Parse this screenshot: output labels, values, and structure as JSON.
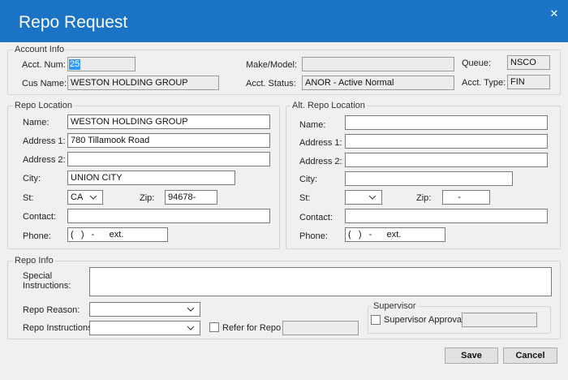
{
  "window": {
    "title": "Repo Request",
    "close_glyph": "✕"
  },
  "account_info": {
    "legend": "Account Info",
    "acct_num_label": "Acct. Num:",
    "acct_num": "25",
    "cus_name_label": "Cus Name:",
    "cus_name": "WESTON HOLDING GROUP",
    "make_model_label": "Make/Model:",
    "make_model": "",
    "acct_status_label": "Acct. Status:",
    "acct_status": "ANOR - Active Normal",
    "queue_label": "Queue:",
    "queue": "NSCO",
    "acct_type_label": "Acct. Type:",
    "acct_type": "FIN"
  },
  "repo_location": {
    "legend": "Repo Location",
    "name_label": "Name:",
    "name": "WESTON HOLDING GROUP",
    "address1_label": "Address 1:",
    "address1": "780 Tillamook Road",
    "address2_label": "Address 2:",
    "address2": "",
    "city_label": "City:",
    "city": "UNION CITY",
    "st_label": "St:",
    "st": "CA",
    "zip_label": "Zip:",
    "zip": "94678-",
    "contact_label": "Contact:",
    "contact": "",
    "phone_label": "Phone:",
    "phone": "(   )   -      ext."
  },
  "alt_repo_location": {
    "legend": "Alt. Repo Location",
    "name_label": "Name:",
    "name": "",
    "address1_label": "Address 1:",
    "address1": "",
    "address2_label": "Address 2:",
    "address2": "",
    "city_label": "City:",
    "city": "",
    "st_label": "St:",
    "st": "",
    "zip_label": "Zip:",
    "zip": "     -",
    "contact_label": "Contact:",
    "contact": "",
    "phone_label": "Phone:",
    "phone": "(   )   -      ext."
  },
  "repo_info": {
    "legend": "Repo Info",
    "special_label_1": "Special",
    "special_label_2": "Instructions:",
    "special_instructions": "",
    "reason_label": "Repo Reason:",
    "reason": "",
    "instructions_label": "Repo Instructions:",
    "instructions": "",
    "refer_label": "Refer for Repo",
    "refer_value": "",
    "supervisor_legend": "Supervisor",
    "supervisor_approval_label": "Supervisor Approval",
    "supervisor_value": ""
  },
  "buttons": {
    "save": "Save",
    "cancel": "Cancel"
  },
  "colors": {
    "title_bar": "#1a73c4",
    "background": "#f0f0f0",
    "selection": "#3399ff"
  },
  "icons": {
    "close": "close-icon",
    "dropdown": "chevron-down-icon"
  }
}
